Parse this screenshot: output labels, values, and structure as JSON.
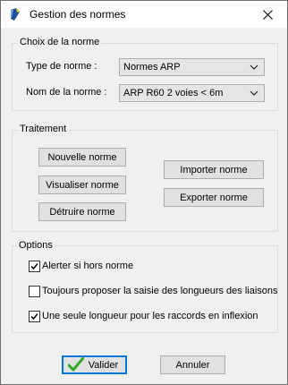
{
  "window": {
    "title": "Gestion des normes"
  },
  "choice": {
    "legend": "Choix de la norme",
    "type_label": "Type de norme :",
    "type_value": "Normes ARP",
    "name_label": "Nom de la norme :",
    "name_value": "ARP R60 2 voies < 6m"
  },
  "treatment": {
    "legend": "Traitement",
    "new_label": "Nouvelle norme",
    "view_label": "Visualiser norme",
    "delete_label": "Détruire norme",
    "import_label": "Importer norme",
    "export_label": "Exporter norme"
  },
  "options": {
    "legend": "Options",
    "items": [
      {
        "label": "Alerter si hors norme",
        "checked": true
      },
      {
        "label": "Toujours proposer la saisie des longueurs des liaisons",
        "checked": false
      },
      {
        "label": "Une seule longueur pour les raccords en inflexion",
        "checked": true
      }
    ]
  },
  "footer": {
    "ok_label": "Valider",
    "cancel_label": "Annuler"
  },
  "colors": {
    "accent": "#0078d7",
    "checkmark_green": "#2fa823"
  }
}
